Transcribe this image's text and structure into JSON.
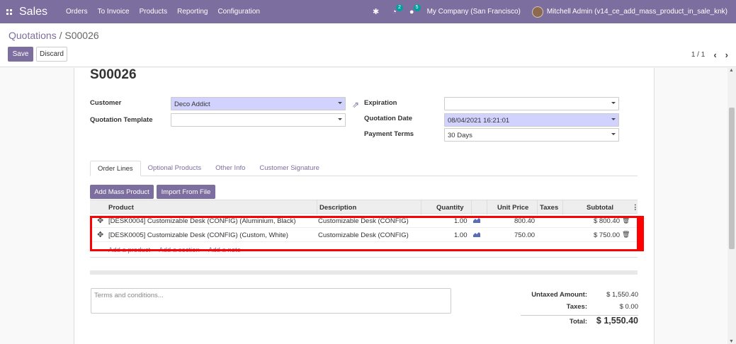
{
  "navbar": {
    "app_name": "Sales",
    "menu": [
      "Orders",
      "To Invoice",
      "Products",
      "Reporting",
      "Configuration"
    ],
    "activity_badge": "2",
    "messages_badge": "5",
    "company": "My Company (San Francisco)",
    "user": "Mitchell Admin (v14_ce_add_mass_product_in_sale_knk)"
  },
  "control": {
    "breadcrumb_parent": "Quotations",
    "breadcrumb_sep": " / ",
    "breadcrumb_current": "S00026",
    "save_label": "Save",
    "discard_label": "Discard",
    "pager": "1 / 1"
  },
  "form": {
    "title": "S00026",
    "customer_label": "Customer",
    "customer_value": "Deco Addict",
    "template_label": "Quotation Template",
    "template_value": "",
    "expiration_label": "Expiration",
    "expiration_value": "",
    "quotation_date_label": "Quotation Date",
    "quotation_date_value": "08/04/2021 16:21:01",
    "payment_terms_label": "Payment Terms",
    "payment_terms_value": "30 Days"
  },
  "tabs": [
    "Order Lines",
    "Optional Products",
    "Other Info",
    "Customer Signature"
  ],
  "buttons": {
    "add_mass_product": "Add Mass Product",
    "import_from_file": "Import From File"
  },
  "table": {
    "headers": {
      "product": "Product",
      "description": "Description",
      "quantity": "Quantity",
      "unit_price": "Unit Price",
      "taxes": "Taxes",
      "subtotal": "Subtotal"
    },
    "rows": [
      {
        "product": "[DESK0004] Customizable Desk (CONFIG) (Aluminium, Black)",
        "description": "Customizable Desk (CONFIG)",
        "quantity": "1.00",
        "unit_price": "800.40",
        "taxes": "",
        "subtotal": "$ 800.40"
      },
      {
        "product": "[DESK0005] Customizable Desk (CONFIG) (Custom, White)",
        "description": "Customizable Desk (CONFIG)",
        "quantity": "1.00",
        "unit_price": "750.00",
        "taxes": "",
        "subtotal": "$ 750.00"
      }
    ],
    "add_links": [
      "Add a product",
      "Add a section",
      "Add a note"
    ]
  },
  "footer": {
    "terms_placeholder": "Terms and conditions...",
    "untaxed_label": "Untaxed Amount:",
    "untaxed_value": "$ 1,550.40",
    "taxes_label": "Taxes:",
    "taxes_value": "$ 0.00",
    "total_label": "Total:",
    "total_value": "$ 1,550.40"
  },
  "colors": {
    "brand": "#7c6e9e",
    "required_field": "#d2d2ff",
    "highlight": "#ff0000"
  }
}
